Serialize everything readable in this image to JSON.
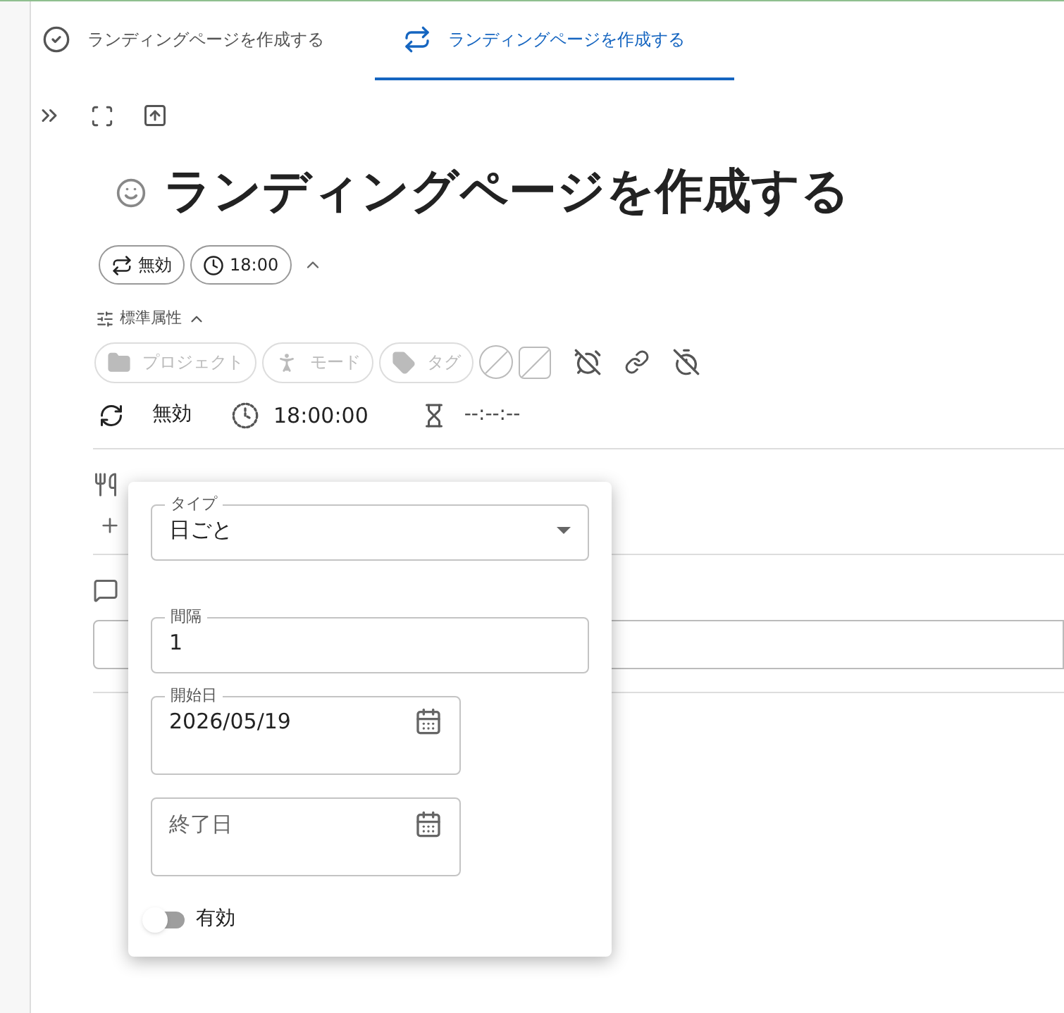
{
  "tabs": [
    {
      "label": "ランディングページを作成する",
      "kind": "done",
      "selected": false
    },
    {
      "label": "ランディングページを作成する",
      "kind": "repeat",
      "selected": true
    }
  ],
  "title": "ランディングページを作成する",
  "chips": [
    {
      "kind": "repeat",
      "label": "無効"
    },
    {
      "kind": "time",
      "label": "18:00"
    }
  ],
  "section": {
    "label": "標準属性",
    "expanded": true
  },
  "attributes": [
    {
      "kind": "project",
      "label": "プロジェクト",
      "disabled": true
    },
    {
      "kind": "mode",
      "label": "モード",
      "disabled": true
    },
    {
      "kind": "tag",
      "label": "タグ",
      "disabled": true
    }
  ],
  "status": {
    "repeat": "無効",
    "time": "18:00:00",
    "duration": "--:--:--"
  },
  "popup": {
    "type": {
      "label": "タイプ",
      "value": "日ごと"
    },
    "interval": {
      "label": "間隔",
      "value": "1"
    },
    "start": {
      "label": "開始日",
      "value": "2026/05/19"
    },
    "end": {
      "placeholder": "終了日"
    },
    "toggle": {
      "label": "有効",
      "on": false
    }
  }
}
